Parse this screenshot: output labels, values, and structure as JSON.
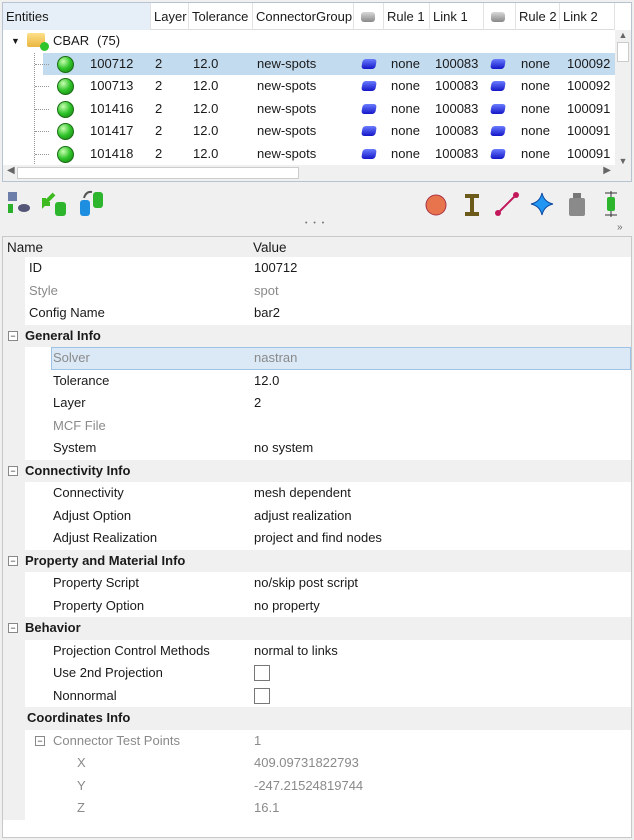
{
  "entities": {
    "columns": [
      "Entities",
      "Layer",
      "Tolerance",
      "ConnectorGroup",
      "",
      "Rule 1",
      "Link 1",
      "",
      "Rule 2",
      "Link 2"
    ],
    "group": {
      "name": "CBAR",
      "count": "(75)"
    },
    "rows": [
      {
        "id": "100712",
        "layer": "2",
        "tol": "12.0",
        "group": "new-spots",
        "rule1": "none",
        "link1": "100083",
        "rule2": "none",
        "link2": "100092",
        "selected": true
      },
      {
        "id": "100713",
        "layer": "2",
        "tol": "12.0",
        "group": "new-spots",
        "rule1": "none",
        "link1": "100083",
        "rule2": "none",
        "link2": "100092"
      },
      {
        "id": "101416",
        "layer": "2",
        "tol": "12.0",
        "group": "new-spots",
        "rule1": "none",
        "link1": "100083",
        "rule2": "none",
        "link2": "100091"
      },
      {
        "id": "101417",
        "layer": "2",
        "tol": "12.0",
        "group": "new-spots",
        "rule1": "none",
        "link1": "100083",
        "rule2": "none",
        "link2": "100091"
      },
      {
        "id": "101418",
        "layer": "2",
        "tol": "12.0",
        "group": "new-spots",
        "rule1": "none",
        "link1": "100083",
        "rule2": "none",
        "link2": "100091"
      }
    ]
  },
  "toolbar": {
    "left": [
      "find-icon",
      "import-icon",
      "export-icon"
    ],
    "right": [
      "sphere-icon",
      "beam-icon",
      "link-icon",
      "star-icon",
      "weight-icon",
      "connector-icon"
    ],
    "dots": "• • •"
  },
  "props": {
    "header": {
      "name": "Name",
      "value": "Value"
    },
    "rows": [
      {
        "type": "p",
        "n": "ID",
        "v": "100712"
      },
      {
        "type": "p",
        "n": "Style",
        "v": "spot",
        "dim": true
      },
      {
        "type": "p",
        "n": "Config Name",
        "v": "bar2"
      },
      {
        "type": "cat",
        "n": "General Info"
      },
      {
        "type": "p",
        "n": "Solver",
        "v": "nastran",
        "dim": true,
        "sel": true,
        "ind": 1
      },
      {
        "type": "p",
        "n": "Tolerance",
        "v": "12.0",
        "ind": 1
      },
      {
        "type": "p",
        "n": "Layer",
        "v": "2",
        "ind": 1
      },
      {
        "type": "p",
        "n": "MCF File",
        "v": "",
        "dim": true,
        "ind": 1
      },
      {
        "type": "p",
        "n": "System",
        "v": "no system",
        "ind": 1
      },
      {
        "type": "cat",
        "n": "Connectivity Info"
      },
      {
        "type": "p",
        "n": "Connectivity",
        "v": "mesh dependent",
        "ind": 1
      },
      {
        "type": "p",
        "n": "Adjust Option",
        "v": "adjust realization",
        "ind": 1
      },
      {
        "type": "p",
        "n": "Adjust Realization",
        "v": "project and find nodes",
        "ind": 1
      },
      {
        "type": "cat",
        "n": "Property and Material Info"
      },
      {
        "type": "p",
        "n": "Property Script",
        "v": "no/skip post script",
        "ind": 1
      },
      {
        "type": "p",
        "n": "Property Option",
        "v": "no property",
        "ind": 1
      },
      {
        "type": "cat",
        "n": "Behavior"
      },
      {
        "type": "p",
        "n": "Projection Control Methods",
        "v": "normal to links",
        "ind": 1
      },
      {
        "type": "p",
        "n": "Use 2nd Projection",
        "check": false,
        "ind": 1
      },
      {
        "type": "p",
        "n": "Nonnormal",
        "check": false,
        "ind": 1
      },
      {
        "type": "cat2",
        "n": "Coordinates Info"
      },
      {
        "type": "p",
        "n": "Connector Test Points",
        "v": "1",
        "dim": true,
        "ind": 1,
        "minus": true
      },
      {
        "type": "p",
        "n": "X",
        "v": "409.09731822793",
        "dim": true,
        "ind": 2
      },
      {
        "type": "p",
        "n": "Y",
        "v": "-247.21524819744",
        "dim": true,
        "ind": 2
      },
      {
        "type": "p",
        "n": "Z",
        "v": "16.1",
        "dim": true,
        "ind": 2
      }
    ]
  }
}
